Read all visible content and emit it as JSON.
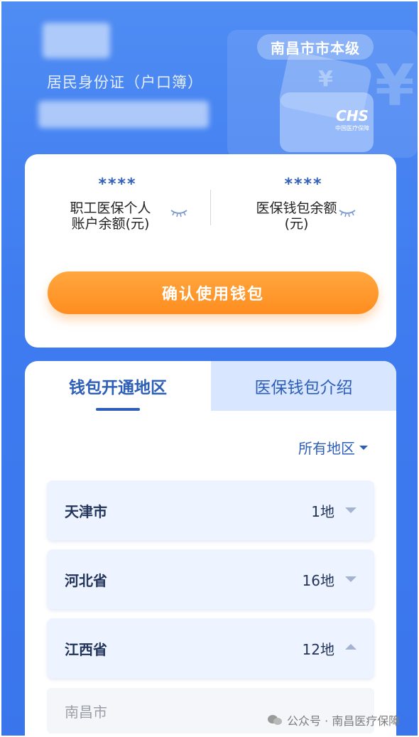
{
  "header": {
    "id_type": "居民身份证（户口簿）",
    "region_badge": "南昌市市本级",
    "card_logo": "CHS",
    "card_logo_sub": "中国医疗保障"
  },
  "balance": {
    "left": {
      "masked": "****",
      "label_line1": "职工医保个人",
      "label_line2": "账户余额(元)"
    },
    "right": {
      "masked": "****",
      "label_line1": "医保钱包余额",
      "label_line2": "(元)"
    },
    "confirm_label": "确认使用钱包"
  },
  "tabs": [
    {
      "label": "钱包开通地区",
      "active": true
    },
    {
      "label": "医保钱包介绍",
      "active": false
    }
  ],
  "filter": {
    "label": "所有地区"
  },
  "regions": [
    {
      "name": "天津市",
      "count": "1地",
      "expanded": false
    },
    {
      "name": "河北省",
      "count": "16地",
      "expanded": false
    },
    {
      "name": "江西省",
      "count": "12地",
      "expanded": true
    }
  ],
  "sub_regions": [
    {
      "name": "南昌市"
    }
  ],
  "watermark": {
    "text": "公众号 · 南昌医疗保障"
  },
  "colors": {
    "accent": "#2d5fb8",
    "button": "#ff9a2e",
    "background": "#3f7cf0"
  }
}
